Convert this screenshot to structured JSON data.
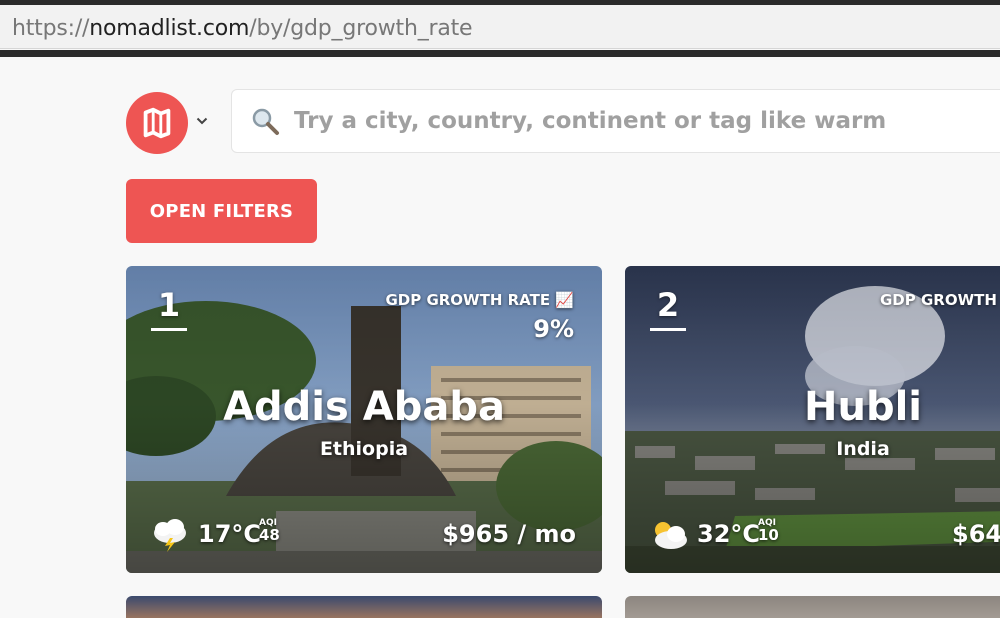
{
  "browser": {
    "url_scheme": "https://",
    "url_host": "nomadlist.com",
    "url_path": "/by/gdp_growth_rate"
  },
  "search": {
    "placeholder": "Try a city, country, continent or tag like warm"
  },
  "filters": {
    "button_label": "OPEN FILTERS"
  },
  "colors": {
    "brand_red": "#ee5553"
  },
  "cards": [
    {
      "rank": "1",
      "metric_label": "GDP GROWTH RATE 📈",
      "metric_value": "9%",
      "city": "Addis Ababa",
      "country": "Ethiopia",
      "weather_icon": "cloud-lightning-icon",
      "temperature": "17°C",
      "aqi_label": "AQI",
      "aqi_value": "48",
      "cost": "$965 / mo"
    },
    {
      "rank": "2",
      "metric_label": "GDP GROWTH",
      "city": "Hubli",
      "country": "India",
      "weather_icon": "sun-behind-cloud-icon",
      "temperature": "32°C",
      "aqi_label": "AQI",
      "aqi_value": "10",
      "cost": "$64"
    }
  ]
}
